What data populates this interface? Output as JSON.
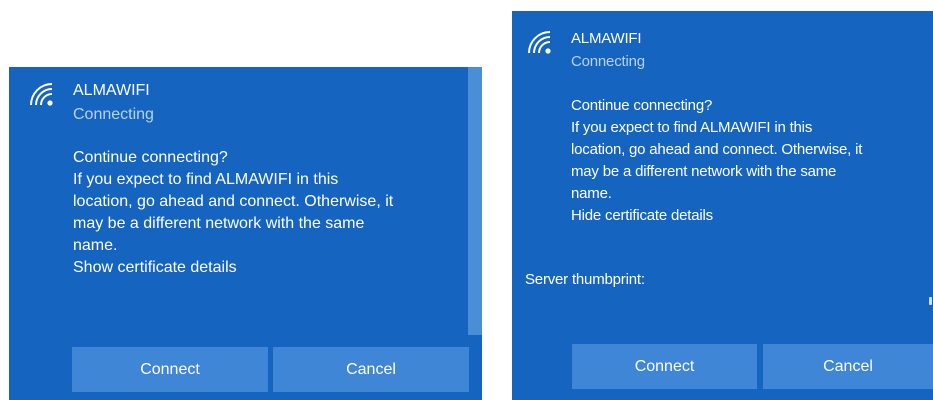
{
  "dialogs": [
    {
      "network_name": "ALMAWIFI",
      "status": "Connecting",
      "message_lines": [
        "Continue connecting?",
        "If you expect to find  ALMAWIFI  in this",
        "location, go ahead and connect. Otherwise, it",
        "may be a different network with the same",
        "name."
      ],
      "certificate_link": "Show certificate details",
      "connect_label": "Connect",
      "cancel_label": "Cancel"
    },
    {
      "network_name": "ALMAWIFI",
      "status": "Connecting",
      "message_lines": [
        "Continue connecting?",
        "If you expect to find  ALMAWIFI  in this",
        "location, go ahead and connect. Otherwise, it",
        "may be a different network with the same",
        "name."
      ],
      "certificate_link": "Hide certificate details",
      "server_thumbprint_label": "Server thumbprint:",
      "connect_label": "Connect",
      "cancel_label": "Cancel"
    }
  ],
  "colors": {
    "panel_background": "#1565c0",
    "button_background": "#3f86d6",
    "status_text": "#b9d2ee",
    "text": "#ffffff"
  },
  "icons": [
    "wifi-signal-icon"
  ]
}
